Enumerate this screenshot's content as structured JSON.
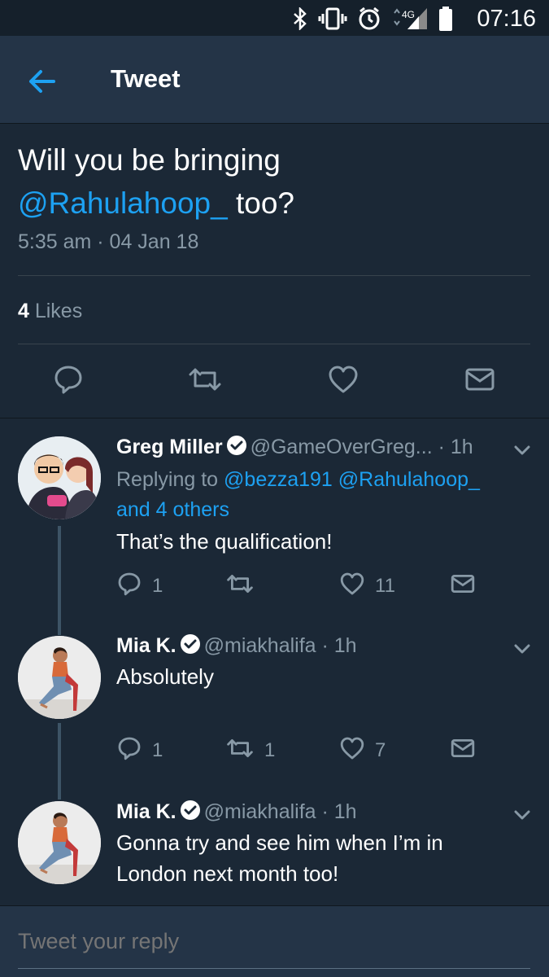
{
  "status_bar": {
    "time": "07:16",
    "network": "4G",
    "icons": [
      "bluetooth-icon",
      "vibrate-icon",
      "alarm-icon",
      "signal-icon",
      "battery-icon"
    ]
  },
  "app_bar": {
    "title": "Tweet",
    "back_icon": "back-arrow-icon"
  },
  "tweet": {
    "text_before": "Will you be bringing",
    "mention": "@Rahulahoop_",
    "text_after": " too?",
    "timestamp": "5:35 am · 04 Jan 18",
    "likes_count": "4",
    "likes_label": " Likes"
  },
  "replies": [
    {
      "name": "Greg Miller",
      "handle": "@GameOverGreg...",
      "time": " · 1h",
      "replying_prefix": "Replying to ",
      "replying_links": "@bezza191 @Rahulahoop_",
      "replying_others": "and 4 others",
      "text": "That’s the qualification!",
      "reply_count": "1",
      "retweet_count": "",
      "like_count": "11"
    },
    {
      "name": "Mia K.",
      "handle": "@miakhalifa",
      "time": " · 1h",
      "text": "Absolutely",
      "reply_count": "1",
      "retweet_count": "1",
      "like_count": "7"
    },
    {
      "name": "Mia K.",
      "handle": "@miakhalifa",
      "time": " · 1h",
      "text_line1": "Gonna try and see him when I’m in",
      "text_line2": "London next month too!"
    }
  ],
  "compose": {
    "placeholder": "Tweet your reply"
  },
  "colors": {
    "background": "#1b2836",
    "bar": "#243447",
    "accent": "#1da1f2",
    "muted": "#8899a6"
  }
}
